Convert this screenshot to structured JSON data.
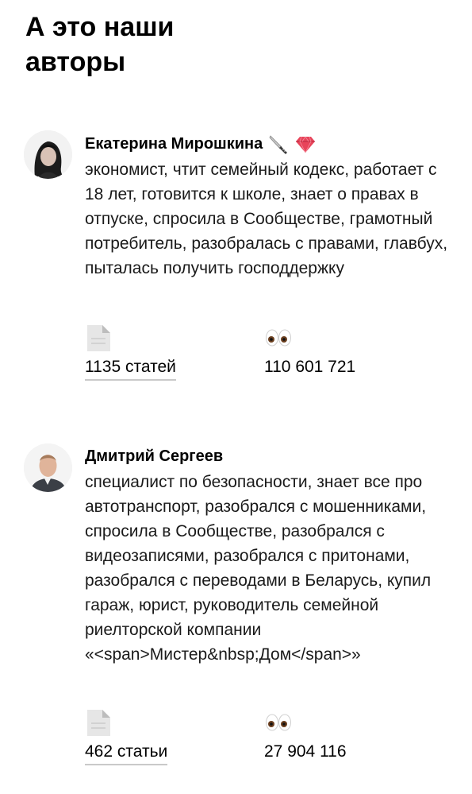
{
  "header": {
    "title": "А это наши авторы"
  },
  "authors": [
    {
      "name": "Екатерина Мирошкина",
      "badges": [
        "knife-icon",
        "gem-icon"
      ],
      "bio": "экономист, чтит семейный кодекс, работает с 18 лет, готовится к школе, знает о правах в отпуске, спросила в Сообществе, грамотный потребитель, разобралась с правами, главбух, пыталась получить господдержку",
      "articles": "1135 статей",
      "views": "110 601 721"
    },
    {
      "name": "Дмитрий Сергеев",
      "badges": [],
      "bio": "специалист по безопасности, знает все про автотранспорт, разобрался с мошенниками, спросила в Сообществе, разобрался с видеозаписями, разобрался с притонами, разобрался с переводами в Беларусь, купил гараж, юрист, руководитель семейной риелторской компании «<span>Мистер&nbsp;Дом</span>»",
      "articles": "462 статьи",
      "views": "27 904 116"
    }
  ],
  "icons": {
    "articles": "document-icon",
    "views": "eyes-icon"
  },
  "colors": {
    "text": "#000000",
    "underline": "#c9c9c9",
    "gem": "#e8445a"
  }
}
